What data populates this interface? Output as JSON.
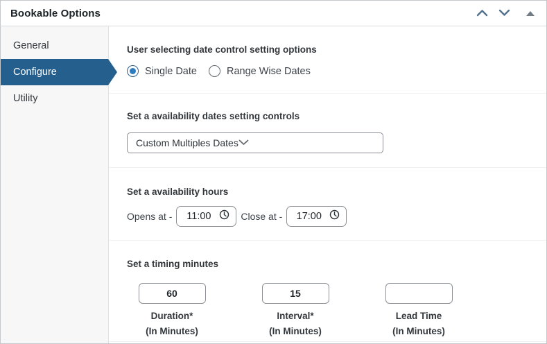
{
  "panel": {
    "title": "Bookable Options",
    "colors": {
      "active_tab": "#255f8e",
      "radio_checked": "#2e7bbd",
      "input_border": "#8c8f94"
    }
  },
  "sidebar": {
    "tabs": [
      {
        "label": "General",
        "active": false
      },
      {
        "label": "Configure",
        "active": true
      },
      {
        "label": "Utility",
        "active": false
      }
    ]
  },
  "sections": {
    "date_control": {
      "label": "User selecting date control setting options",
      "radios": [
        {
          "label": "Single Date",
          "checked": true
        },
        {
          "label": "Range Wise Dates",
          "checked": false
        }
      ]
    },
    "availability_dates": {
      "label": "Set a availability dates setting controls",
      "selected_option": "Custom Multiples Dates"
    },
    "availability_hours": {
      "label": "Set a availability hours",
      "opens_label": "Opens at -",
      "opens_value": "11:00",
      "close_label": "Close at -",
      "close_value": "17:00"
    },
    "timing_minutes": {
      "label": "Set a timing minutes",
      "fields": [
        {
          "value": "60",
          "name": "Duration*",
          "unit": "(In Minutes)"
        },
        {
          "value": "15",
          "name": "Interval*",
          "unit": "(In Minutes)"
        },
        {
          "value": "",
          "name": "Lead Time",
          "unit": "(In Minutes)"
        }
      ]
    }
  }
}
